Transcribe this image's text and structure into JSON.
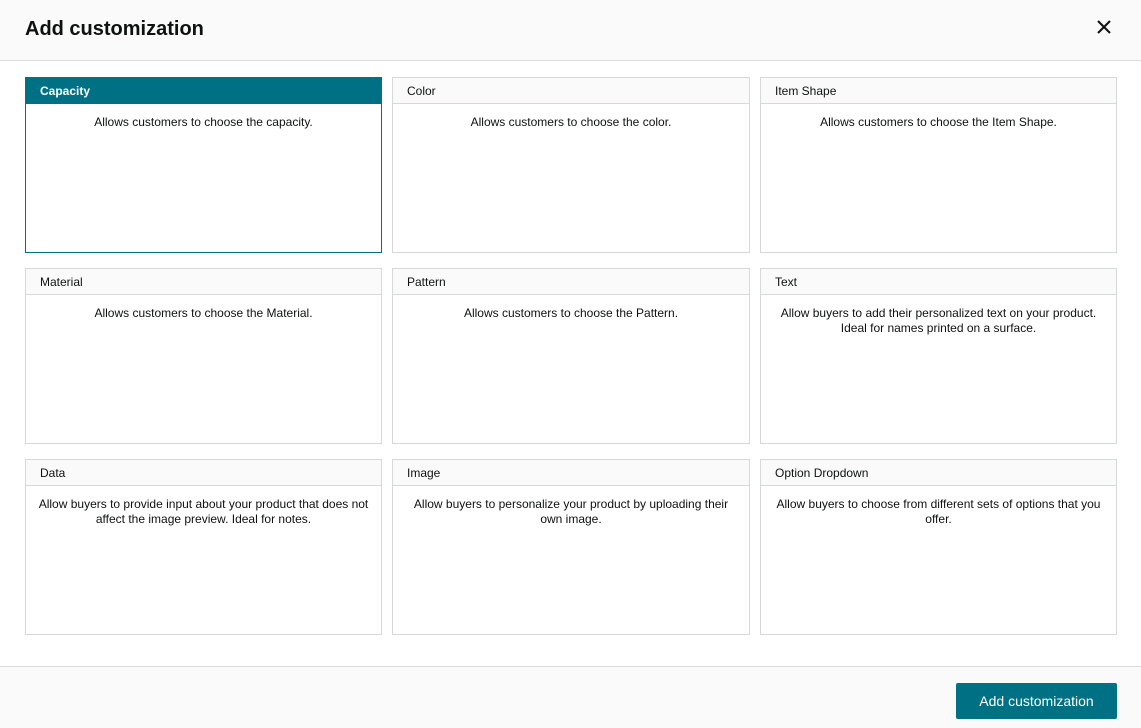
{
  "modal": {
    "title": "Add customization",
    "close_icon": "close-icon",
    "footer": {
      "add_button_label": "Add customization"
    }
  },
  "colors": {
    "accent": "#007185",
    "header_bg": "#fafafa",
    "border": "#d5d9d9"
  },
  "selected_card": "Capacity",
  "cards": [
    {
      "title": "Capacity",
      "description": "Allows customers to choose the capacity."
    },
    {
      "title": "Color",
      "description": "Allows customers to choose the color."
    },
    {
      "title": "Item Shape",
      "description": "Allows customers to choose the Item Shape."
    },
    {
      "title": "Material",
      "description": "Allows customers to choose the Material."
    },
    {
      "title": "Pattern",
      "description": "Allows customers to choose the Pattern."
    },
    {
      "title": "Text",
      "description": "Allow buyers to add their personalized text on your product. Ideal for names printed on a surface."
    },
    {
      "title": "Data",
      "description": "Allow buyers to provide input about your product that does not affect the image preview. Ideal for notes."
    },
    {
      "title": "Image",
      "description": "Allow buyers to personalize your product by uploading their own image."
    },
    {
      "title": "Option Dropdown",
      "description": "Allow buyers to choose from different sets of options that you offer."
    }
  ]
}
